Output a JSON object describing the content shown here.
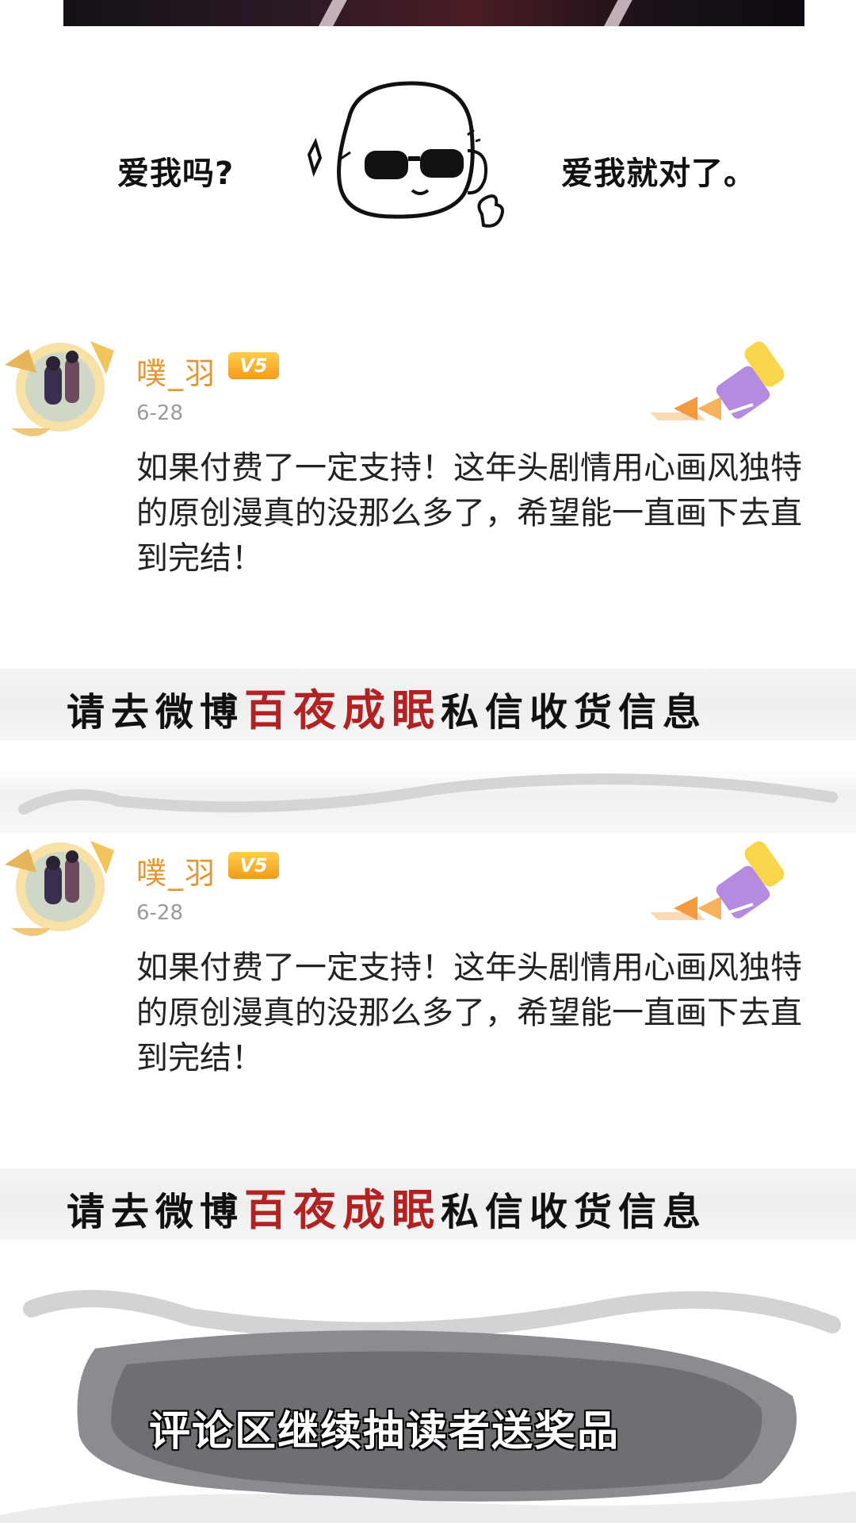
{
  "header_mascot": {
    "left_text": "爱我吗?",
    "right_text": "爱我就对了。"
  },
  "comments": [
    {
      "username": "噗_羽",
      "vip_label": "V5",
      "date": "6-28",
      "text": "如果付费了一定支持！这年头剧情用心画风独特的原创漫真的没那么多了，希望能一直画下去直到完结！"
    },
    {
      "username": "噗_羽",
      "vip_label": "V5",
      "date": "6-28",
      "text": "如果付费了一定支持！这年头剧情用心画风独特的原创漫真的没那么多了，希望能一直画下去直到完结！"
    }
  ],
  "banners": [
    {
      "prefix": "请去微博",
      "highlight": "百夜成眠",
      "suffix": "私信收货信息"
    },
    {
      "prefix": "请去微博",
      "highlight": "百夜成眠",
      "suffix": "私信收货信息"
    }
  ],
  "footer": {
    "text": "评论区继续抽读者送奖品"
  },
  "colors": {
    "username": "#e7962d",
    "highlight": "#b22222",
    "vip": "#f39a1a"
  }
}
